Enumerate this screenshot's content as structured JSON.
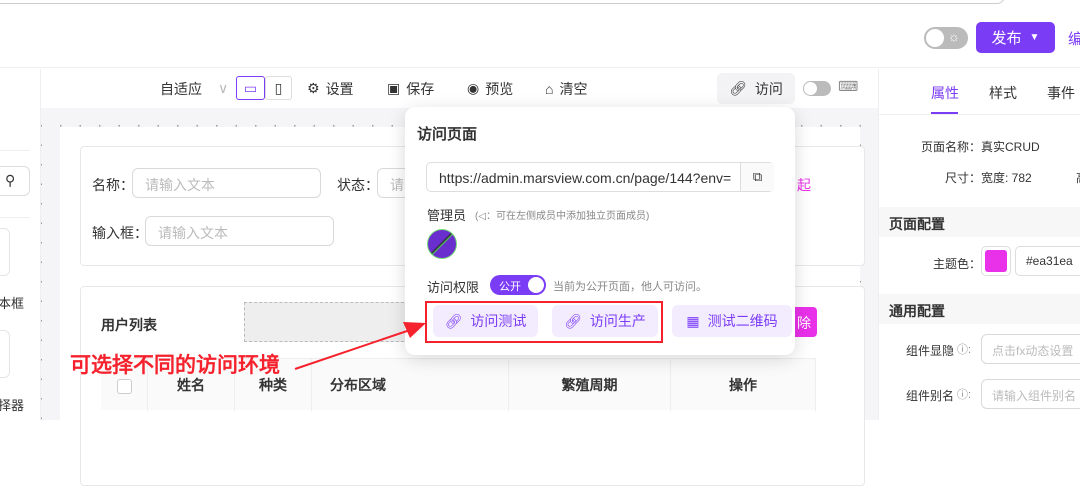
{
  "header": {
    "publish_label": "发布",
    "edit_label": "编"
  },
  "sidebar": {
    "items": [
      {
        "label": "本框"
      },
      {
        "label": "择器"
      }
    ]
  },
  "toolbar": {
    "adaptive": "自适应",
    "settings": "设置",
    "save": "保存",
    "preview": "预览",
    "clear": "清空",
    "visit": "访问"
  },
  "form": {
    "name_label": "名称：",
    "name_placeholder": "请输入文本",
    "status_label": "状态：",
    "status_placeholder": "请输",
    "input_label": "输入框：",
    "input_placeholder": "请输入文本",
    "collapse": "起"
  },
  "table": {
    "title": "用户列表",
    "delete_btn": "除",
    "columns": [
      "姓名",
      "种类",
      "分布区域",
      "繁殖周期",
      "操作"
    ]
  },
  "popover": {
    "title": "访问页面",
    "url": "https://admin.marsview.com.cn/page/144?env=",
    "admin_label": "管理员",
    "admin_hint": "(◁：可在左侧成员中添加独立页面成员)",
    "permission_label": "访问权限",
    "toggle_label": "公开",
    "permission_hint": "当前为公开页面，他人可访问。",
    "btn_test": "访问测试",
    "btn_prod": "访问生产",
    "btn_qr": "测试二维码"
  },
  "annotation": "可选择不同的访问环境",
  "panel": {
    "tabs": [
      "属性",
      "样式",
      "事件"
    ],
    "page_name_label": "页面名称：",
    "page_name": "真实CRUD",
    "size_label": "尺寸：",
    "size_value": "宽度: 782",
    "size_h": "高",
    "page_config": "页面配置",
    "theme_label": "主题色：",
    "theme_value": "#ea31ea",
    "general_config": "通用配置",
    "visibility_label": "组件显隐",
    "visibility_placeholder": "点击fx动态设置",
    "alias_label": "组件别名",
    "alias_placeholder": "请输入组件别名"
  },
  "colors": {
    "accent": "#7b3cf6",
    "theme": "#ea31ea",
    "annotation": "#f5222d"
  }
}
